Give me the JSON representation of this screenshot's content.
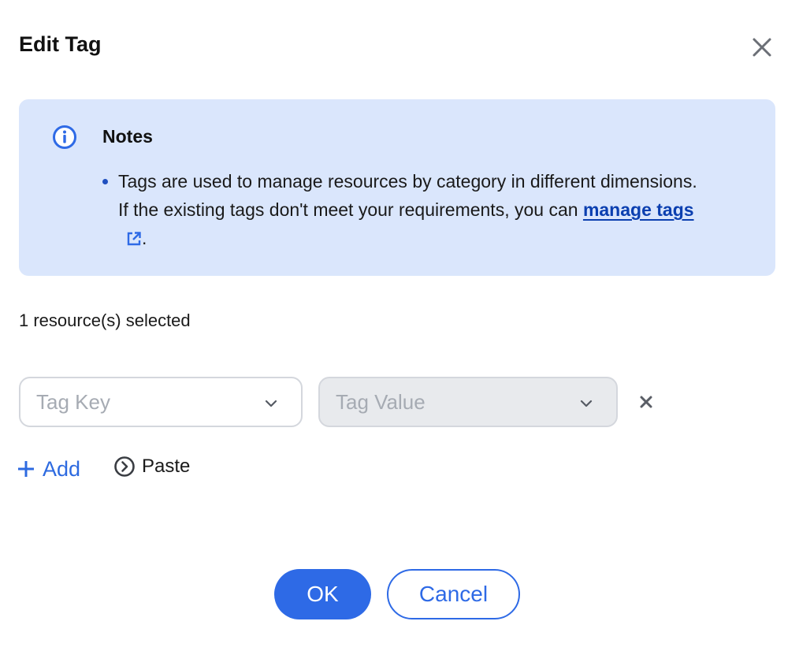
{
  "dialog": {
    "title": "Edit Tag",
    "close_icon": "close-icon"
  },
  "notes": {
    "icon": "info-circle-icon",
    "title": "Notes",
    "text_before_link": "Tags are used to manage resources by category in different dimensions. If the existing tags don't meet your requirements, you can ",
    "link_label": "manage tags",
    "link_icon": "external-link-icon",
    "text_after_link": "."
  },
  "selection": {
    "count_text": "1 resource(s) selected"
  },
  "tag_row": {
    "key_placeholder": "Tag Key",
    "value_placeholder": "Tag Value",
    "remove_icon": "close-icon"
  },
  "actions": {
    "add_label": "Add",
    "paste_label": "Paste"
  },
  "footer": {
    "ok_label": "OK",
    "cancel_label": "Cancel"
  },
  "colors": {
    "accent": "#2e6ae6",
    "notes_background": "#dae6fc",
    "link": "#0b3fb0",
    "disabled_field": "#e8eaed",
    "placeholder": "#a6abb3"
  }
}
